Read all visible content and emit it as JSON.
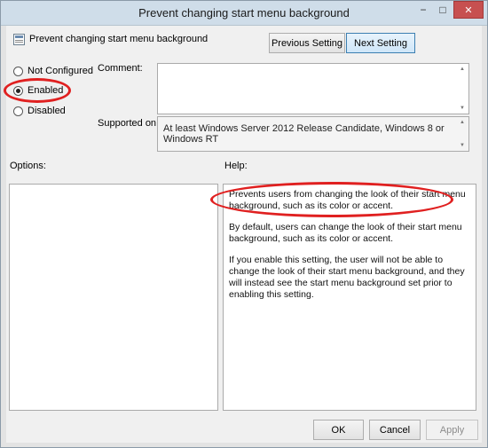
{
  "window": {
    "title": "Prevent changing start menu background",
    "controls": {
      "minimize": "−",
      "maximize": "□",
      "close": "✕"
    }
  },
  "header": {
    "icon": "policy-setting-icon",
    "title": "Prevent changing start menu background"
  },
  "nav": {
    "previous_label": "Previous Setting",
    "next_label": "Next Setting"
  },
  "state_options": [
    {
      "label": "Not Configured",
      "checked": false
    },
    {
      "label": "Enabled",
      "checked": true
    },
    {
      "label": "Disabled",
      "checked": false
    }
  ],
  "comment": {
    "label": "Comment:",
    "value": ""
  },
  "supported": {
    "label": "Supported on:",
    "value": "At least Windows Server 2012 Release Candidate, Windows 8 or Windows RT"
  },
  "options": {
    "label": "Options:"
  },
  "help": {
    "label": "Help:",
    "paragraphs": [
      "Prevents users from changing the look of their start menu background, such as its color or accent.",
      "By default, users can change the look of their start menu background, such as its color or accent.",
      "If you enable this setting, the user will not be able to change the look of their start menu background, and they will instead see the start menu background set prior to enabling this setting."
    ]
  },
  "footer": {
    "ok_label": "OK",
    "cancel_label": "Cancel",
    "apply_label": "Apply"
  },
  "annotation_color": "#e02020"
}
